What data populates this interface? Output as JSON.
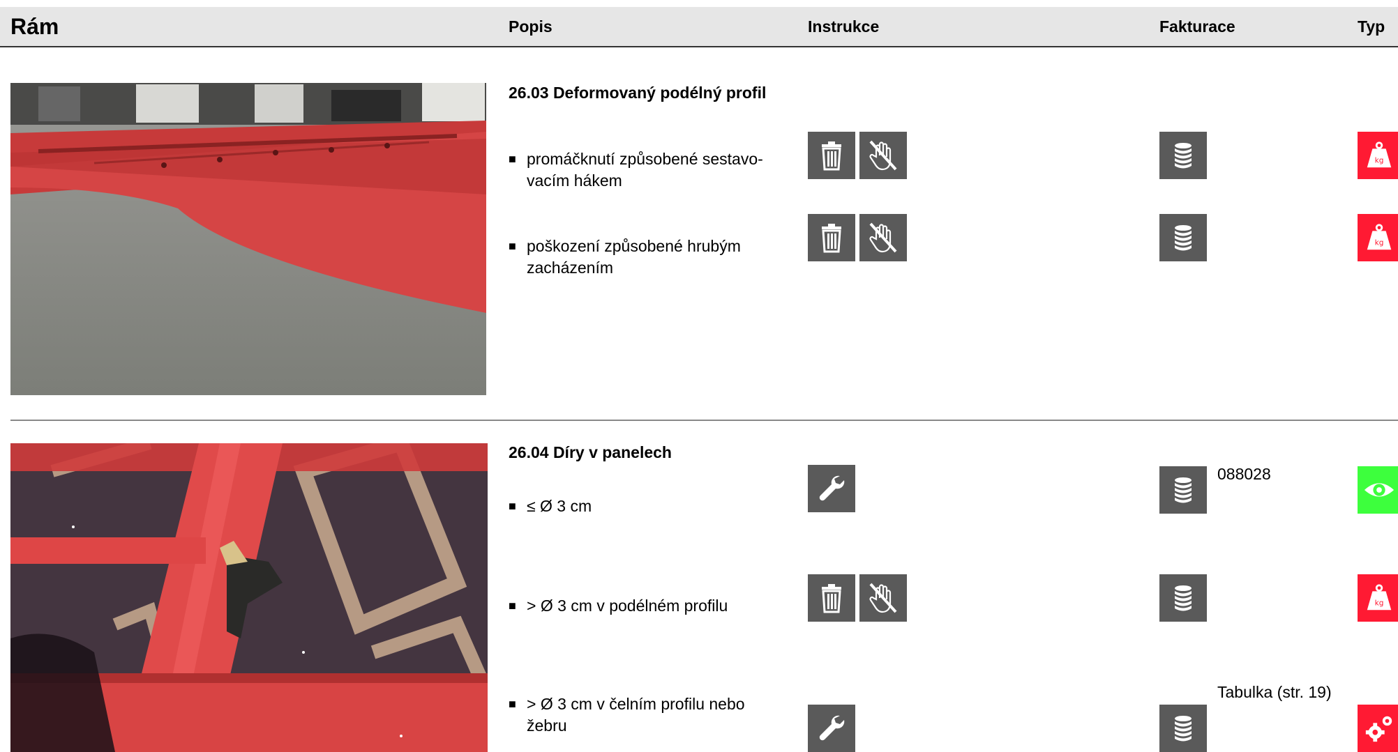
{
  "header": {
    "title": "Rám",
    "col_popis": "Popis",
    "col_instrukce": "Instrukce",
    "col_fakturace": "Fakturace",
    "col_typ": "Typ"
  },
  "sections": [
    {
      "title": "26.03 Deformovaný podélný profil",
      "items": [
        {
          "bullet": "■",
          "text": "promáčknutí způsobené sestavo-vacím hákem",
          "instructions": [
            "trash-icon",
            "no-touch-icon"
          ],
          "billing": "coins-icon",
          "billing_note": "",
          "type": "weight-kg-icon",
          "type_color": "#ff1a33"
        },
        {
          "bullet": "■",
          "text": "poškození způsobené hrubým zacházením",
          "instructions": [
            "trash-icon",
            "no-touch-icon"
          ],
          "billing": "coins-icon",
          "billing_note": "",
          "type": "weight-kg-icon",
          "type_color": "#ff1a33"
        }
      ]
    },
    {
      "title": "26.04 Díry v panelech",
      "items": [
        {
          "bullet": "■",
          "text": "≤ Ø 3 cm",
          "instructions": [
            "wrench-icon"
          ],
          "billing": "coins-icon",
          "billing_note": "088028",
          "type": "eye-icon",
          "type_color": "#3dff3d"
        },
        {
          "bullet": "■",
          "text": "> Ø 3 cm v podélném profilu",
          "instructions": [
            "trash-icon",
            "no-touch-icon"
          ],
          "billing": "coins-icon",
          "billing_note": "",
          "type": "weight-kg-icon",
          "type_color": "#ff1a33"
        },
        {
          "bullet": "■",
          "text": "> Ø 3 cm v čelním profilu nebo žebru",
          "instructions": [
            "wrench-icon"
          ],
          "billing": "coins-icon",
          "billing_note": "Tabulka (str. 19)",
          "type": "gears-icon",
          "type_color": "#ff1a33"
        }
      ]
    }
  ],
  "colors": {
    "icon_bg": "#5a5a5a",
    "header_bg": "#e6e6e6",
    "red": "#ff1a33",
    "green": "#3dff3d"
  }
}
